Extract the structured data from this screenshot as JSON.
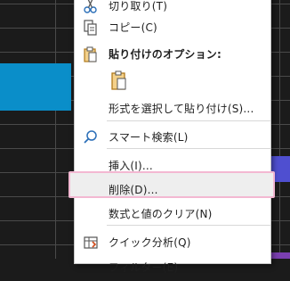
{
  "menu": {
    "items": {
      "cut": {
        "label": "切り取り(T)"
      },
      "copy": {
        "label": "コピー(C)"
      },
      "paste_options": {
        "label": "貼り付けのオプション:"
      },
      "paste_special": {
        "label": "形式を選択して貼り付け(S)..."
      },
      "smart_lookup": {
        "label": "スマート検索(L)"
      },
      "insert": {
        "label": "挿入(I)..."
      },
      "delete": {
        "label": "削除(D)..."
      },
      "clear_contents": {
        "label": "数式と値のクリア(N)"
      },
      "quick_analysis": {
        "label": "クイック分析(Q)"
      },
      "filter": {
        "label": "フィルター(E)"
      }
    }
  },
  "colors": {
    "highlight_border": "#f3b8d2",
    "selection_blue": "#0a8ec9",
    "menu_background": "#ffffff"
  }
}
